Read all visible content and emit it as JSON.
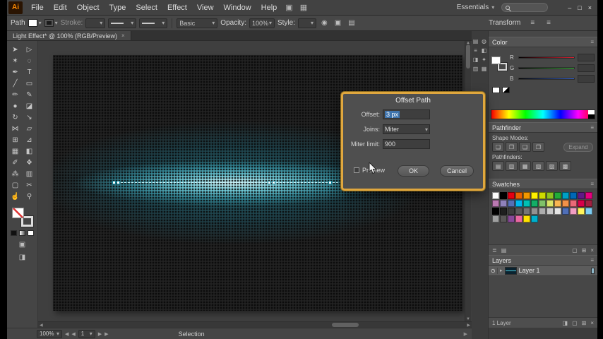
{
  "icons": {
    "dropdown": "▾",
    "menu": "≡",
    "close": "×",
    "eye": "⊙",
    "triangle_right": "▸",
    "left_arrow": "◀",
    "right_arrow": "▶",
    "up_arrow": "▲",
    "down_arrow": "▼",
    "recolor": "◉",
    "doc_setup": "▣",
    "preferences": "▤",
    "libraries": "≣",
    "kinds": "▤",
    "new_group": "▢",
    "new_item": "⊞",
    "delete": "×",
    "mask": "◨",
    "target": "◦"
  },
  "menubar": {
    "logo_text": "Ai",
    "items": [
      "File",
      "Edit",
      "Object",
      "Type",
      "Select",
      "Effect",
      "View",
      "Window",
      "Help"
    ],
    "app_icons": [
      {
        "name": "bridge-icon",
        "glyph": "▣"
      },
      {
        "name": "arrange-documents-icon",
        "glyph": "▦"
      }
    ],
    "workspace_label": "Essentials",
    "window_buttons": [
      {
        "name": "minimize-button",
        "glyph": "–"
      },
      {
        "name": "restore-button",
        "glyph": "□"
      },
      {
        "name": "close-button",
        "glyph": "×"
      }
    ]
  },
  "controlbar": {
    "selection_label": "Path",
    "stroke_label": "Stroke:",
    "brush_value": "Basic",
    "opacity_label": "Opacity:",
    "opacity_value": "100%",
    "style_label": "Style:",
    "transform_label": "Transform"
  },
  "tabbar": {
    "document_title": "Light Effect* @ 100% (RGB/Preview)"
  },
  "toolbar": {
    "tools": [
      {
        "name": "selection",
        "glyph": "➤"
      },
      {
        "name": "direct-selection",
        "glyph": "▷"
      },
      {
        "name": "magic-wand",
        "glyph": "✶"
      },
      {
        "name": "lasso",
        "glyph": "◌"
      },
      {
        "name": "pen",
        "glyph": "✒"
      },
      {
        "name": "type",
        "glyph": "T"
      },
      {
        "name": "line-segment",
        "glyph": "╱"
      },
      {
        "name": "rectangle",
        "glyph": "▭"
      },
      {
        "name": "paintbrush",
        "glyph": "✏"
      },
      {
        "name": "pencil",
        "glyph": "✎"
      },
      {
        "name": "blob-brush",
        "glyph": "●"
      },
      {
        "name": "eraser",
        "glyph": "◪"
      },
      {
        "name": "rotate",
        "glyph": "↻"
      },
      {
        "name": "scale",
        "glyph": "↘"
      },
      {
        "name": "width",
        "glyph": "⋈"
      },
      {
        "name": "free-transform",
        "glyph": "▱"
      },
      {
        "name": "shape-builder",
        "glyph": "⊞"
      },
      {
        "name": "perspective-grid",
        "glyph": "⊿"
      },
      {
        "name": "mesh",
        "glyph": "▦"
      },
      {
        "name": "gradient",
        "glyph": "◧"
      },
      {
        "name": "eyedropper",
        "glyph": "✐"
      },
      {
        "name": "blend",
        "glyph": "❖"
      },
      {
        "name": "symbol-sprayer",
        "glyph": "⁂"
      },
      {
        "name": "column-graph",
        "glyph": "▥"
      },
      {
        "name": "artboard",
        "glyph": "▢"
      },
      {
        "name": "slice",
        "glyph": "✂"
      },
      {
        "name": "hand",
        "glyph": "☝"
      },
      {
        "name": "zoom",
        "glyph": "⚲"
      }
    ]
  },
  "dock": {
    "icons": [
      {
        "name": "info-panel-icon",
        "glyph": "▤"
      },
      {
        "name": "appearance-panel-icon",
        "glyph": "◍"
      },
      {
        "name": "stroke-panel-icon",
        "glyph": "≡"
      },
      {
        "name": "gradient-panel-icon",
        "glyph": "◧"
      },
      {
        "name": "transparency-panel-icon",
        "glyph": "◨"
      },
      {
        "name": "symbols-panel-icon",
        "glyph": "✦"
      },
      {
        "name": "brushes-panel-icon",
        "glyph": "▥"
      },
      {
        "name": "graphic-styles-panel-icon",
        "glyph": "▦"
      }
    ]
  },
  "panels": {
    "color": {
      "title": "Color",
      "channels": [
        {
          "label": "R"
        },
        {
          "label": "G"
        },
        {
          "label": "B"
        }
      ]
    },
    "pathfinder": {
      "title": "Pathfinder",
      "shape_modes_label": "Shape Modes:",
      "expand_label": "Expand",
      "pathfinders_label": "Pathfinders:",
      "shape_mode_buttons": [
        {
          "name": "unite",
          "glyph": "❏"
        },
        {
          "name": "minus-front",
          "glyph": "❐"
        },
        {
          "name": "intersect",
          "glyph": "❑"
        },
        {
          "name": "exclude",
          "glyph": "❒"
        }
      ],
      "pathfinder_buttons": [
        {
          "name": "divide",
          "glyph": "▤"
        },
        {
          "name": "trim",
          "glyph": "▥"
        },
        {
          "name": "merge",
          "glyph": "▦"
        },
        {
          "name": "crop",
          "glyph": "▧"
        },
        {
          "name": "outline",
          "glyph": "▨"
        },
        {
          "name": "minus-back",
          "glyph": "▩"
        }
      ]
    },
    "swatches": {
      "title": "Swatches",
      "rows": [
        [
          "#ffffff",
          "#000000",
          "#e60012",
          "#eb6100",
          "#f39800",
          "#fff100",
          "#cfdb00",
          "#8fc31f",
          "#22ac38",
          "#00a0c6",
          "#0068b7",
          "#601986",
          "#e4007f"
        ],
        [
          "#ba79b1",
          "#8f82bc",
          "#556fb5",
          "#00b7ee",
          "#00c0b4",
          "#13ae67",
          "#80c269",
          "#d9e367",
          "#f8b551",
          "#f19149",
          "#eb6877",
          "#d7004a",
          "#a22041"
        ],
        [
          "#000000",
          "#1f1f1f",
          "#3d3d3d",
          "#595959",
          "#757575",
          "#919191",
          "#adadad",
          "#c9c9c9",
          "#e5e5e5",
          "#4f6fb8",
          "#f19ec2",
          "#fff45c",
          "#7ecef4"
        ],
        [
          "#9fa0a0",
          "#595757",
          "#884898",
          "#ea68a2",
          "#ffe200",
          "#00afcc"
        ]
      ]
    },
    "layers": {
      "title": "Layers",
      "layer_name": "Layer 1",
      "count_label": "1 Layer"
    }
  },
  "dialog": {
    "title": "Offset Path",
    "offset_label": "Offset:",
    "offset_value": "3 px",
    "joins_label": "Joins:",
    "joins_value": "Miter",
    "miter_limit_label": "Miter limit:",
    "miter_limit_value": "900",
    "preview_label": "Preview",
    "ok_label": "OK",
    "cancel_label": "Cancel"
  },
  "statusbar": {
    "zoom": "100%",
    "artboard_number": "1",
    "status_label": "Selection"
  },
  "colors": {
    "dialog_accent": "#e0a73e",
    "glow_cyan": "#7ee4f0",
    "selection_highlight": "#3f74ad"
  }
}
